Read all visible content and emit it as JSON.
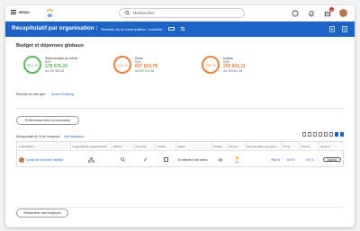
{
  "topbar": {
    "menu_label": "MENU",
    "search_placeholder": "Rechercher",
    "notification_count": "3"
  },
  "header": {
    "title": "Récapitulatif par organisation :",
    "subtitle": "Révision de la rémunération : Annuelle"
  },
  "budget": {
    "title": "Budget et dépenses globaux",
    "metrics": [
      {
        "percent": "95,4 %",
        "label": "Rémunération au mérite",
        "currency": "EUR",
        "value": "178 976,26",
        "sub": "sur 187 668,81",
        "color": "#5cb85c"
      },
      {
        "percent": "100 %",
        "label": "Prime",
        "currency": "EUR",
        "value": "607 810,78",
        "sub": "sur 607 810,54",
        "color": "#f07d3c"
      },
      {
        "percent": "100 %",
        "label": "Actions",
        "currency": "EUR",
        "value": "253 831,11",
        "sub": "sur 253 831,93",
        "color": "#f07d3c"
      }
    ]
  },
  "reviewed": {
    "label": "Révision en tant que :",
    "name": "Susan Goldberg"
  },
  "prefs_button": "Préférences liées au processus",
  "table": {
    "caption": "Récapitulatif du % de l'employé",
    "caption_link": "Vert Indicateur",
    "headers": [
      "Organisation",
      "Organisations subordonnées",
      "Afficher",
      "Proposer",
      "Clôturé",
      "Statut",
      "Préfixe",
      "Erreurs",
      "Rémunération au mérite",
      "Prime",
      "Actions",
      "Actions"
    ],
    "row": {
      "org": "Centre de recherche médical",
      "status": "En attente d'une action",
      "errors": "(1)",
      "merit": "98,8 %",
      "prime": "100 %",
      "actions_pct": "100 %",
      "action_btn": "Actions"
    }
  },
  "footer_button": "Rechercher des employés"
}
